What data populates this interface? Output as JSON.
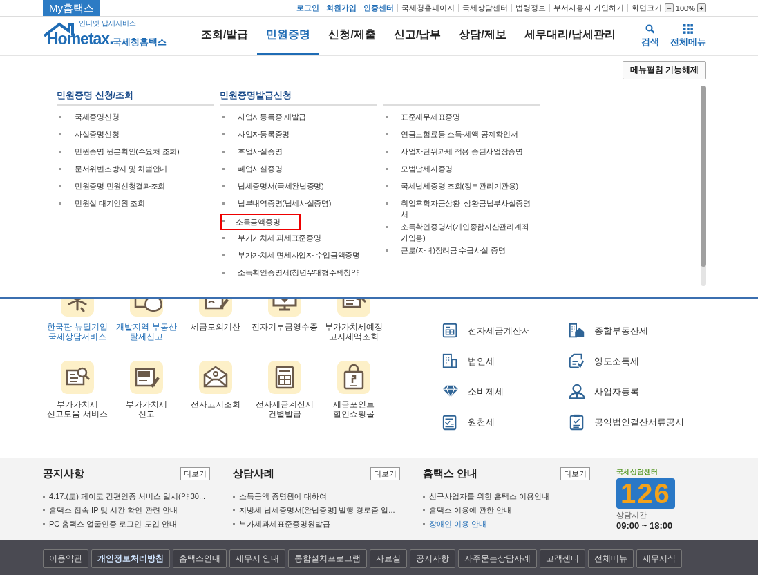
{
  "top_bar": {
    "my_tab": "My홈택스",
    "links": [
      {
        "label": "로그인",
        "kind": "strong"
      },
      {
        "label": "회원가입",
        "kind": "strong"
      },
      {
        "label": "인증센터",
        "kind": "strong"
      },
      {
        "label": "국세청홈페이지",
        "kind": "plain"
      },
      {
        "label": "국세상담센터",
        "kind": "plain"
      },
      {
        "label": "법령정보",
        "kind": "plain"
      },
      {
        "label": "부서사용자 가입하기",
        "kind": "plain"
      }
    ],
    "zoom": {
      "label": "화면크기",
      "minus": "−",
      "value": "100%",
      "plus": "+"
    }
  },
  "header": {
    "logo": {
      "tagline": "인터넷 납세서비스",
      "wordmark": "Hometax.",
      "name": "국세청홈택스"
    },
    "nav": [
      {
        "label": "조회/발급",
        "selected": false
      },
      {
        "label": "민원증명",
        "selected": true
      },
      {
        "label": "신청/제출",
        "selected": false
      },
      {
        "label": "신고/납부",
        "selected": false
      },
      {
        "label": "상담/제보",
        "selected": false
      },
      {
        "label": "세무대리/납세관리",
        "selected": false
      }
    ],
    "actions": [
      {
        "label": "검색",
        "kind": "search"
      },
      {
        "label": "전체메뉴",
        "kind": "grid"
      }
    ]
  },
  "mega_menu": {
    "toggle_button": "메뉴펼침 기능해제",
    "columns": [
      {
        "heading": "민원증명 신청/조회",
        "items": [
          {
            "label": "국세증명신청",
            "highlighted": false
          },
          {
            "label": "사실증명신청",
            "highlighted": false
          },
          {
            "label": "민원증명 원본확인(수요처 조회)",
            "highlighted": false
          },
          {
            "label": "문서위변조방지 및 처벌안내",
            "highlighted": false
          },
          {
            "label": "민원증명 민원신청결과조회",
            "highlighted": false
          },
          {
            "label": "민원실 대기인원 조회",
            "highlighted": false
          }
        ]
      },
      {
        "heading": "민원증명발급신청",
        "items": [
          {
            "label": "사업자등록증 재발급",
            "highlighted": false
          },
          {
            "label": "사업자등록증명",
            "highlighted": false
          },
          {
            "label": "휴업사실증명",
            "highlighted": false
          },
          {
            "label": "폐업사실증명",
            "highlighted": false
          },
          {
            "label": "납세증명서(국세완납증명)",
            "highlighted": false
          },
          {
            "label": "납부내역증명(납세사실증명)",
            "highlighted": false
          },
          {
            "label": "소득금액증명",
            "highlighted": true
          },
          {
            "label": "부가가치세 과세표준증명",
            "highlighted": false
          },
          {
            "label": "부가가치세 면세사업자 수입금액증명",
            "highlighted": false
          },
          {
            "label": "소득확인증명서(청년우대형주택청약",
            "highlighted": false
          }
        ]
      },
      {
        "items": [
          {
            "label": "표준재무제표증명",
            "highlighted": false
          },
          {
            "label": "연금보험료등 소득·세액 공제확인서",
            "highlighted": false
          },
          {
            "label": "사업자단위과세 적용 종된사업장증명",
            "highlighted": false
          },
          {
            "label": "모범납세자증명",
            "highlighted": false
          },
          {
            "label": "국세납세증명 조회(정부관리기관용)",
            "highlighted": false
          },
          {
            "label": "취업후학자금상환_상환금납부사실증명서",
            "highlighted": false
          },
          {
            "label": "소득확인증명서(개인종합자산관리계좌 가입용)",
            "highlighted": false
          },
          {
            "label": "근로(자녀)장려금 수급사실 증명",
            "highlighted": false
          }
        ]
      }
    ]
  },
  "quick_services": [
    {
      "label": "한국판 뉴딜기업\n국세상담서비스",
      "kind": "spark",
      "emphasized": true
    },
    {
      "label": "개발지역 부동산\n탈세신고",
      "kind": "moneybag",
      "emphasized": true
    },
    {
      "label": "세금모의계산",
      "kind": "docpen",
      "emphasized": false
    },
    {
      "label": "전자기부금영수증",
      "kind": "monitor",
      "emphasized": false
    },
    {
      "label": "부가가치세예정\n고지세액조회",
      "kind": "docsearch",
      "emphasized": false
    },
    {
      "label": "부가가치세\n신고도움 서비스",
      "kind": "docsearch",
      "emphasized": false
    },
    {
      "label": "부가가치세\n신고",
      "kind": "vat",
      "emphasized": false
    },
    {
      "label": "전자고지조회",
      "kind": "envelope",
      "emphasized": false
    },
    {
      "label": "전자세금계산서\n건별발급",
      "kind": "calculator",
      "emphasized": false
    },
    {
      "label": "세금포인트\n할인쇼핑몰",
      "kind": "bag",
      "emphasized": false
    }
  ],
  "tax_list": [
    {
      "label": "전자세금계산서",
      "kind": "invoice"
    },
    {
      "label": "종합부동산세",
      "kind": "house"
    },
    {
      "label": "법인세",
      "kind": "buildings"
    },
    {
      "label": "양도소득세",
      "kind": "doccheck"
    },
    {
      "label": "소비제세",
      "kind": "diamond"
    },
    {
      "label": "사업자등록",
      "kind": "person"
    },
    {
      "label": "원천세",
      "kind": "sal"
    },
    {
      "label": "공익법인결산서류공시",
      "kind": "clipboard"
    }
  ],
  "notices": [
    {
      "title": "공지사항",
      "more": "더보기",
      "items": [
        {
          "label": "4.17.(토) 페이코 간편인증 서비스 일시(약 30...",
          "emphasized": false
        },
        {
          "label": "홈택스 접속 IP 및 시간 확인 관련 안내",
          "emphasized": false
        },
        {
          "label": "PC 홈택스 얼굴인증 로그인 도입 안내",
          "emphasized": false
        }
      ]
    },
    {
      "title": "상담사례",
      "more": "더보기",
      "items": [
        {
          "label": "소득금액 증명원에 대하여",
          "emphasized": false
        },
        {
          "label": "지방세 납세증명서[완납증명] 발행 경로좀 알...",
          "emphasized": false
        },
        {
          "label": "부가세과세표준증명원발급",
          "emphasized": false
        }
      ]
    },
    {
      "title": "홈택스 안내",
      "more": "더보기",
      "items": [
        {
          "label": "신규사업자를 위한 홈택스 이용안내",
          "emphasized": false
        },
        {
          "label": "홈택스 이용에 관한 안내",
          "emphasized": false
        },
        {
          "label": "장애인 이용 안내",
          "emphasized": true
        }
      ]
    }
  ],
  "call_center": {
    "title": "국세상담센터",
    "number": "126",
    "hours_label": "상담시간",
    "hours": "09:00 ~ 18:00"
  },
  "footer_links": [
    {
      "label": "이용약관",
      "bold": false
    },
    {
      "label": "개인정보처리방침",
      "bold": true
    },
    {
      "label": "홈택스안내",
      "bold": false
    },
    {
      "label": "세무서 안내",
      "bold": false
    },
    {
      "label": "통합설치프로그램",
      "bold": false
    },
    {
      "label": "자료실",
      "bold": false
    },
    {
      "label": "공지사항",
      "bold": false
    },
    {
      "label": "자주묻는상담사례",
      "bold": false
    },
    {
      "label": "고객센터",
      "bold": false
    },
    {
      "label": "전체메뉴",
      "bold": false
    },
    {
      "label": "세무서식",
      "bold": false
    }
  ]
}
